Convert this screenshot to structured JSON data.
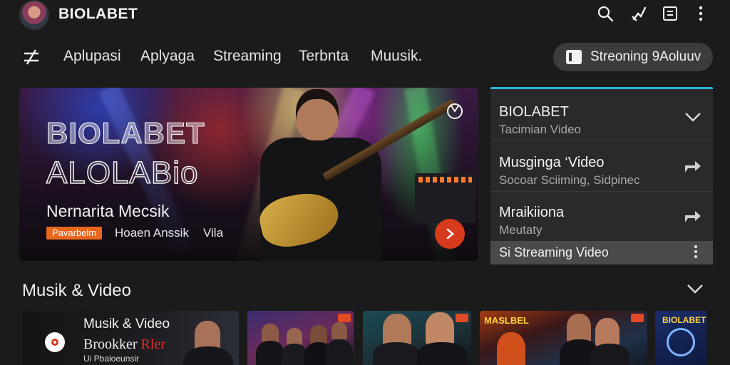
{
  "header": {
    "brand": "BIOLABET"
  },
  "nav": {
    "items": [
      "Aplupasi",
      "Aplyaga",
      "Streaming",
      "Terbnta",
      "Muusik."
    ],
    "pill_label": "Streoning 9Aoluuv"
  },
  "hero": {
    "title_line1": "BIOLABET",
    "title_line2": "ALOLABio",
    "subtitle": "Nernarita Mecsik",
    "tag": "Pavarbelm",
    "tag_text1": "Hoaen Anssik",
    "tag_text2": "Vila"
  },
  "side": {
    "items": [
      {
        "title": "BIOLABET",
        "subtitle": "Tacimian Video"
      },
      {
        "title": "Musginga ‘Video",
        "subtitle": "Socoar Sciiming, Sidpinec"
      },
      {
        "title": "Mraikiiona",
        "subtitle": "Meutaty"
      }
    ],
    "bottom_label": "Si Streaming Video"
  },
  "section": {
    "title": "Musik & Video"
  },
  "cards": {
    "card1": {
      "title": "Musik & Video",
      "subtitle": "Brookker",
      "subtitle_accent": "Rler",
      "caption": "Ui Pbaloeunsir"
    },
    "card4": {
      "title": "MASLBEL"
    },
    "card5": {
      "title": "BIOLABET"
    }
  },
  "colors": {
    "accent_line": "#2fb2d8",
    "play_button": "#d83a1e",
    "tag": "#e8661e"
  }
}
